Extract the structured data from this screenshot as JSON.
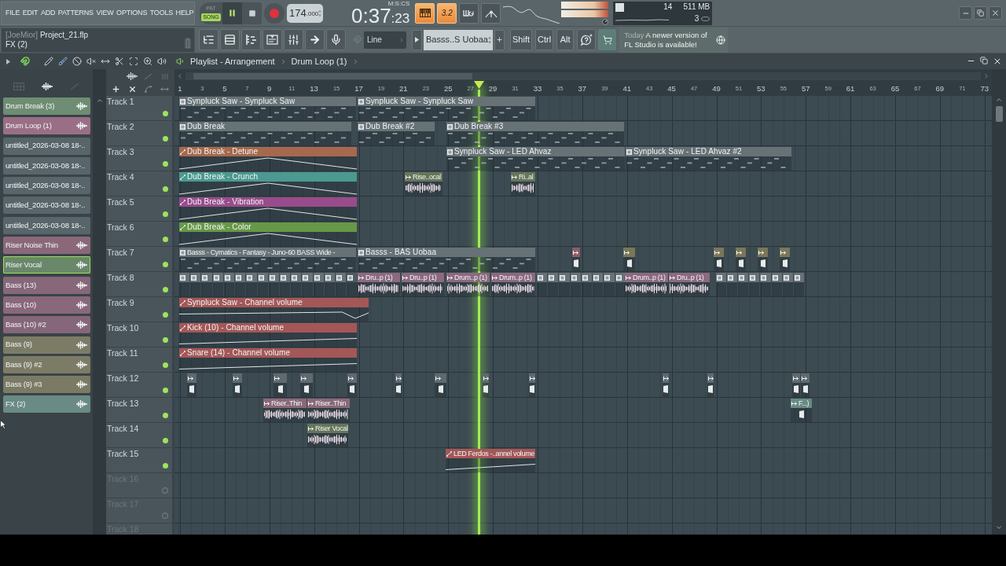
{
  "menu": [
    "FILE",
    "EDIT",
    "ADD",
    "PATTERNS",
    "VIEW",
    "OPTIONS",
    "TOOLS",
    "HELP"
  ],
  "transport": {
    "modes": [
      {
        "label": "PAT",
        "selected": false
      },
      {
        "label": "SONG",
        "selected": true
      }
    ],
    "playing": true,
    "tempo": {
      "whole": "174",
      "fraction": ".000"
    }
  },
  "time": {
    "main": "0:37",
    "centis": ":23",
    "unit": "M:S:CS"
  },
  "toggles": [
    {
      "kind": "keys",
      "on": true
    },
    {
      "kind": "label",
      "label": "3.2",
      "on": true
    },
    {
      "kind": "loop",
      "on": false
    },
    {
      "kind": "metronome",
      "on": false
    }
  ],
  "master_meter": [
    {
      "level": 1
    },
    {
      "level": 1
    }
  ],
  "performance": {
    "count_1": "14",
    "memory": "511 MB",
    "count_2": "3"
  },
  "project": {
    "user": "[JoeMior]",
    "file": "Project_21.flp",
    "focus": "FX (2)"
  },
  "snap": "Line",
  "pattern": "Basss..S Uobaa",
  "keys": [
    "Shift",
    "Ctrl",
    "Alt"
  ],
  "news": {
    "date": "Today",
    "message": "A newer version of FL Studio is available!"
  },
  "playlist": {
    "title": "Playlist - Arrangement",
    "path": "Drum Loop (1)"
  },
  "picker": [
    {
      "name": "Drum Break (3)",
      "kind": "audio",
      "color": "#6e8d73",
      "selected": false
    },
    {
      "name": "Drum Loop (1)",
      "kind": "audio",
      "color": "#9a6f86",
      "selected": false
    },
    {
      "name": "untitled_2026-03-08 18-..",
      "kind": "plain",
      "color": "#58656a",
      "selected": false
    },
    {
      "name": "untitled_2026-03-08 18-..",
      "kind": "plain",
      "color": "#58656a",
      "selected": false
    },
    {
      "name": "untitled_2026-03-08 18-..",
      "kind": "plain",
      "color": "#58656a",
      "selected": false
    },
    {
      "name": "untitled_2026-03-08 18-..",
      "kind": "plain",
      "color": "#58656a",
      "selected": false
    },
    {
      "name": "untitled_2026-03-08 18-..",
      "kind": "plain",
      "color": "#58656a",
      "selected": false
    },
    {
      "name": "Riser Noise Thin",
      "kind": "audio",
      "color": "#8a687a",
      "selected": false
    },
    {
      "name": "Riser Vocal",
      "kind": "audio",
      "color": "#69886a",
      "selected": true
    },
    {
      "name": "Bass (13)",
      "kind": "audio",
      "color": "#87677a",
      "selected": false
    },
    {
      "name": "Bass (10)",
      "kind": "audio",
      "color": "#8a687c",
      "selected": false
    },
    {
      "name": "Bass (10) #2",
      "kind": "audio",
      "color": "#86667a",
      "selected": false
    },
    {
      "name": "Bass (9)",
      "kind": "audio",
      "color": "#7c7c66",
      "selected": false
    },
    {
      "name": "Bass (9) #2",
      "kind": "audio",
      "color": "#7c7c66",
      "selected": false
    },
    {
      "name": "Bass (9) #3",
      "kind": "audio",
      "color": "#7b7a64",
      "selected": false
    },
    {
      "name": "FX (2)",
      "kind": "audio",
      "color": "#698a85",
      "selected": false
    }
  ],
  "ruler": [
    "1",
    "3",
    "5",
    "7",
    "9",
    "11",
    "13",
    "15",
    "17",
    "19",
    "21",
    "23",
    "25",
    "27",
    "29",
    "31",
    "33",
    "35",
    "37",
    "39",
    "41",
    "43",
    "45",
    "47",
    "49",
    "51",
    "53",
    "55",
    "57",
    "59",
    "61",
    "63",
    "65",
    "67",
    "69",
    "71",
    "73"
  ],
  "tracks": [
    {
      "name": "Track 1",
      "active": true,
      "clips": [
        {
          "label": "Synpluck Saw - Synpluck Saw",
          "kind": "pattern",
          "color": "#677276"
        },
        {
          "label": "Synpluck Saw - Synpluck Saw",
          "kind": "pattern",
          "color": "#677276"
        }
      ]
    },
    {
      "name": "Track 2",
      "active": true,
      "clips": [
        {
          "label": "Dub Break",
          "kind": "pattern",
          "color": "#677276"
        },
        {
          "label": "Dub Break #2",
          "kind": "pattern",
          "color": "#677276"
        },
        {
          "label": "Dub Break #3",
          "kind": "pattern",
          "color": "#677276"
        }
      ]
    },
    {
      "name": "Track 3",
      "active": true,
      "clips": [
        {
          "label": "Dub Break - Detune",
          "kind": "automation",
          "color": "#a6694e"
        },
        {
          "label": "Synpluck Saw - LED Ahvaz",
          "kind": "pattern",
          "color": "#677276"
        },
        {
          "label": "Synpluck Saw - LED Ahvaz #2",
          "kind": "pattern",
          "color": "#677276"
        }
      ]
    },
    {
      "name": "Track 4",
      "active": true,
      "clips": [
        {
          "label": "Dub Break - Crunch",
          "kind": "automation",
          "color": "#4b9990"
        },
        {
          "label": "Rise..ocal",
          "kind": "audio",
          "color": "#66755a"
        },
        {
          "label": "Ri..al",
          "kind": "audio",
          "color": "#66755a"
        }
      ]
    },
    {
      "name": "Track 5",
      "active": true,
      "clips": [
        {
          "label": "Dub Break - Vibration",
          "kind": "automation",
          "color": "#994c8c"
        }
      ]
    },
    {
      "name": "Track 6",
      "active": true,
      "clips": [
        {
          "label": "Dub Break - Color",
          "kind": "automation",
          "color": "#679847"
        }
      ]
    },
    {
      "name": "Track 7",
      "active": true,
      "clips": [
        {
          "label": "Basss - Cymatics - Fantasy - Juno-60 BASS Wide -",
          "kind": "pattern",
          "color": "#677276"
        },
        {
          "label": "Basss - BAS Uobaa",
          "kind": "pattern",
          "color": "#677276"
        },
        {
          "kind": "audio",
          "color": "#8b5d68"
        },
        {
          "kind": "audio",
          "color": "#7a7758"
        },
        {
          "kind": "audio",
          "color": "#7a7758"
        },
        {
          "kind": "audio",
          "color": "#7a7758"
        },
        {
          "kind": "audio",
          "color": "#7a7758"
        },
        {
          "kind": "audio",
          "color": "#7a7758"
        }
      ]
    },
    {
      "name": "Track 8",
      "active": true,
      "clips": [
        {
          "kind": "pattern",
          "color": "#677276"
        },
        {
          "kind": "pattern",
          "color": "#677276"
        },
        {
          "kind": "pattern",
          "color": "#677276"
        },
        {
          "kind": "pattern",
          "color": "#677276"
        },
        {
          "kind": "pattern",
          "color": "#677276"
        },
        {
          "kind": "pattern",
          "color": "#677276"
        },
        {
          "kind": "pattern",
          "color": "#677276"
        },
        {
          "kind": "pattern",
          "color": "#677276"
        },
        {
          "kind": "pattern",
          "color": "#677276"
        },
        {
          "kind": "pattern",
          "color": "#677276"
        },
        {
          "kind": "pattern",
          "color": "#677276"
        },
        {
          "kind": "pattern",
          "color": "#677276"
        },
        {
          "kind": "pattern",
          "color": "#677276"
        },
        {
          "kind": "pattern",
          "color": "#677276"
        },
        {
          "kind": "pattern",
          "color": "#677276"
        },
        {
          "kind": "pattern",
          "color": "#4f5a5e"
        },
        {
          "label": "Dru..p (1)",
          "kind": "audio",
          "color": "#8b6a80"
        },
        {
          "label": "Dru..p (1)",
          "kind": "audio",
          "color": "#8b6a80"
        },
        {
          "label": "Drum..p (1)",
          "kind": "audio",
          "color": "#8b6a80"
        },
        {
          "label": "Drum..p (1)",
          "kind": "audio",
          "color": "#8b6a80"
        },
        {
          "kind": "pattern",
          "color": "#677276"
        },
        {
          "kind": "pattern",
          "color": "#677276"
        },
        {
          "kind": "pattern",
          "color": "#677276"
        },
        {
          "kind": "pattern",
          "color": "#677276"
        },
        {
          "kind": "pattern",
          "color": "#677276"
        },
        {
          "kind": "pattern",
          "color": "#677276"
        },
        {
          "kind": "pattern",
          "color": "#677276"
        },
        {
          "kind": "pattern",
          "color": "#677276"
        },
        {
          "label": "Drum..p (1)",
          "kind": "audio",
          "color": "#8b6a80"
        },
        {
          "label": "Dru..p (1)",
          "kind": "audio",
          "color": "#8b6a80"
        },
        {
          "kind": "pattern",
          "color": "#677276"
        },
        {
          "kind": "pattern",
          "color": "#677276"
        },
        {
          "kind": "pattern",
          "color": "#677276"
        },
        {
          "kind": "pattern",
          "color": "#677276"
        },
        {
          "kind": "pattern",
          "color": "#677276"
        },
        {
          "kind": "pattern",
          "color": "#677276"
        },
        {
          "kind": "pattern",
          "color": "#677276"
        },
        {
          "kind": "pattern",
          "color": "#677276"
        }
      ]
    },
    {
      "name": "Track 9",
      "active": true,
      "clips": [
        {
          "label": "Synpluck Saw - Channel volume",
          "kind": "automation",
          "color": "#a45757"
        }
      ]
    },
    {
      "name": "Track 10",
      "active": true,
      "clips": [
        {
          "label": "Kick (10) - Channel volume",
          "kind": "automation",
          "color": "#a45757"
        }
      ]
    },
    {
      "name": "Track 11",
      "active": true,
      "clips": [
        {
          "label": "Snare (14) - Channel volume",
          "kind": "automation",
          "color": "#a45757"
        }
      ]
    },
    {
      "name": "Track 12",
      "active": true,
      "clips": [
        {
          "kind": "audio",
          "color": "#5e6a6f"
        },
        {
          "kind": "audio",
          "color": "#5e6a6f"
        },
        {
          "kind": "audio",
          "color": "#5e6a6f"
        },
        {
          "kind": "audio",
          "color": "#5e6a6f"
        },
        {
          "kind": "audio",
          "color": "#5e6a6f"
        },
        {
          "kind": "audio",
          "color": "#5e6a6f"
        },
        {
          "kind": "audio",
          "color": "#5e6a6f"
        },
        {
          "kind": "audio",
          "color": "#5e6a6f"
        },
        {
          "kind": "audio",
          "color": "#5e6a6f"
        },
        {
          "kind": "audio",
          "color": "#5e6a6f"
        },
        {
          "kind": "audio",
          "color": "#5e6a6f"
        },
        {
          "kind": "audio",
          "color": "#5e6a6f"
        },
        {
          "kind": "audio",
          "color": "#5e6a6f"
        }
      ]
    },
    {
      "name": "Track 13",
      "active": true,
      "clips": [
        {
          "label": "Riser..Thin",
          "kind": "audio",
          "color": "#8a6878"
        },
        {
          "label": "Riser..Thin",
          "kind": "audio",
          "color": "#8a6878"
        },
        {
          "label": "F...)",
          "kind": "audio",
          "color": "#688a84"
        }
      ]
    },
    {
      "name": "Track 14",
      "active": true,
      "clips": [
        {
          "label": "Riser Vocal",
          "kind": "audio",
          "color": "#66755a"
        }
      ]
    },
    {
      "name": "Track 15",
      "active": true,
      "clips": [
        {
          "label": "LED Ferdos -..annel volume",
          "kind": "automation",
          "color": "#a45757"
        }
      ]
    },
    {
      "name": "Track 16",
      "active": false
    },
    {
      "name": "Track 17",
      "active": false
    },
    {
      "name": "Track 18",
      "active": false
    }
  ]
}
